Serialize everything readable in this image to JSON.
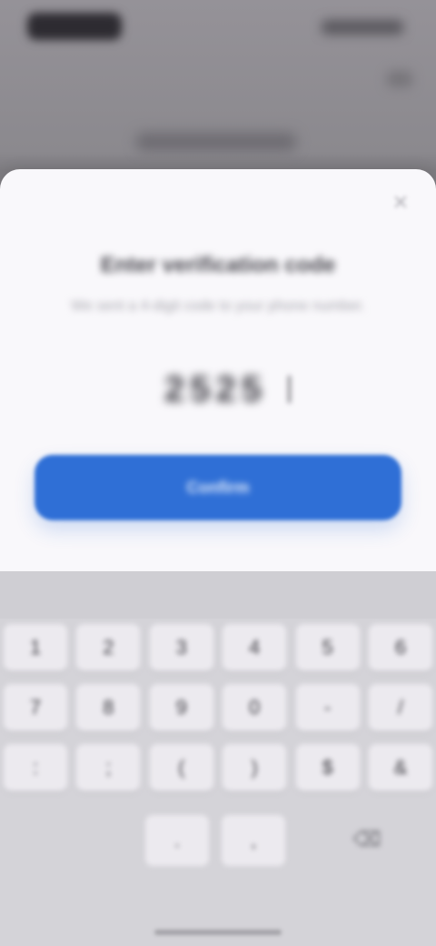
{
  "status_bar": {
    "time": "9:41"
  },
  "background_page": {
    "title": "Verify"
  },
  "sheet": {
    "title": "Enter verification code",
    "description": "We sent a 4-digit code to your phone number.",
    "code_value": "2525",
    "confirm_label": "Confirm"
  },
  "keyboard": {
    "rows": [
      [
        "1",
        "2",
        "3",
        "4",
        "5",
        "6"
      ],
      [
        "7",
        "8",
        "9",
        "0",
        "-",
        "/"
      ],
      [
        ":",
        ";",
        "(",
        ")",
        "$",
        "&"
      ]
    ],
    "bottom_keys": [
      ".",
      ","
    ],
    "delete_glyph": "⌫"
  },
  "icons": {
    "close": "close-icon",
    "delete": "backspace-icon"
  },
  "colors": {
    "accent": "#2f6fd6",
    "sheet_bg": "#f9f8fb",
    "keyboard_bg": "#d4d3d8"
  }
}
